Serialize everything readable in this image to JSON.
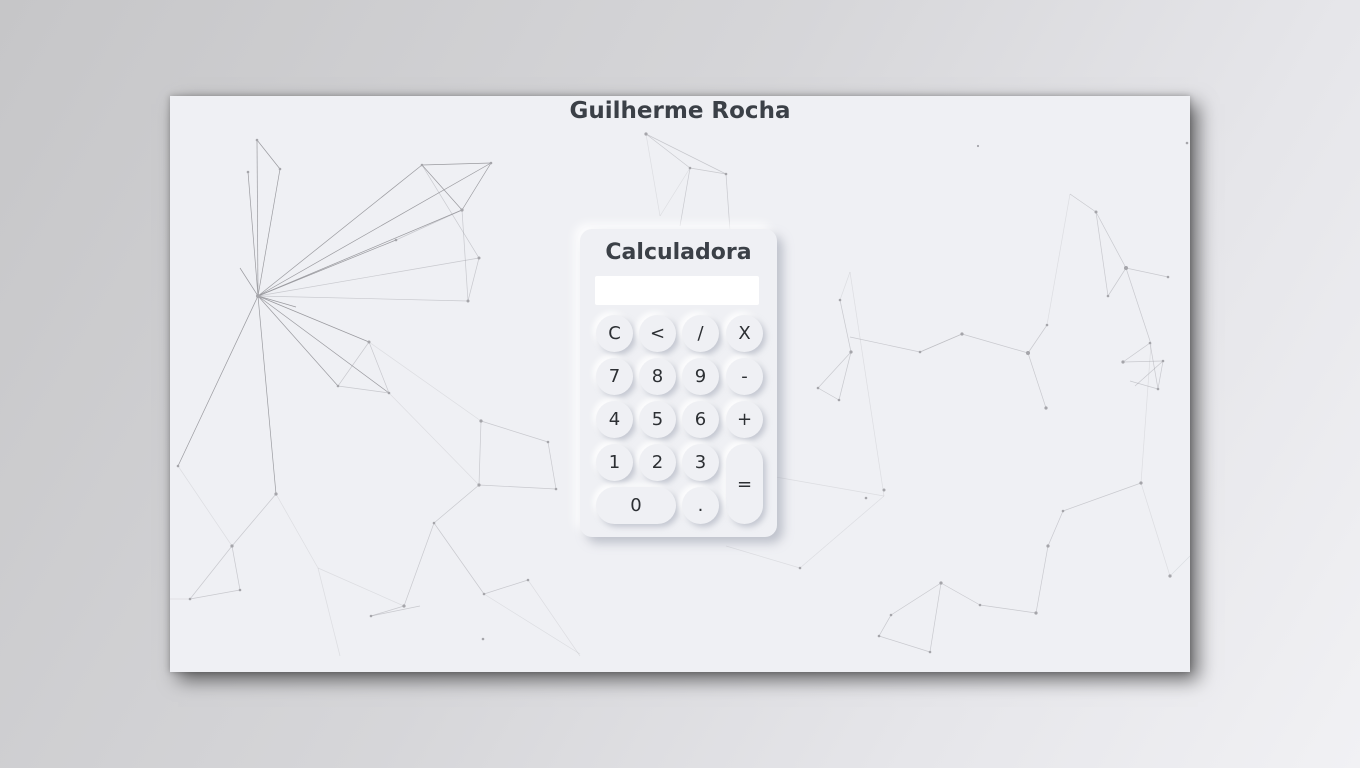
{
  "page": {
    "title": "Guilherme Rocha"
  },
  "calculator": {
    "title": "Calculadora",
    "display_value": "",
    "keys": {
      "clear": "C",
      "backspace": "<",
      "divide": "/",
      "multiply": "X",
      "seven": "7",
      "eight": "8",
      "nine": "9",
      "minus": "-",
      "four": "4",
      "five": "5",
      "six": "6",
      "plus": "+",
      "one": "1",
      "two": "2",
      "three": "3",
      "equals": "=",
      "zero": "0",
      "decimal": "."
    }
  },
  "colors": {
    "background": "#eff0f4",
    "text": "#3b4047",
    "display": "#ffffff"
  }
}
